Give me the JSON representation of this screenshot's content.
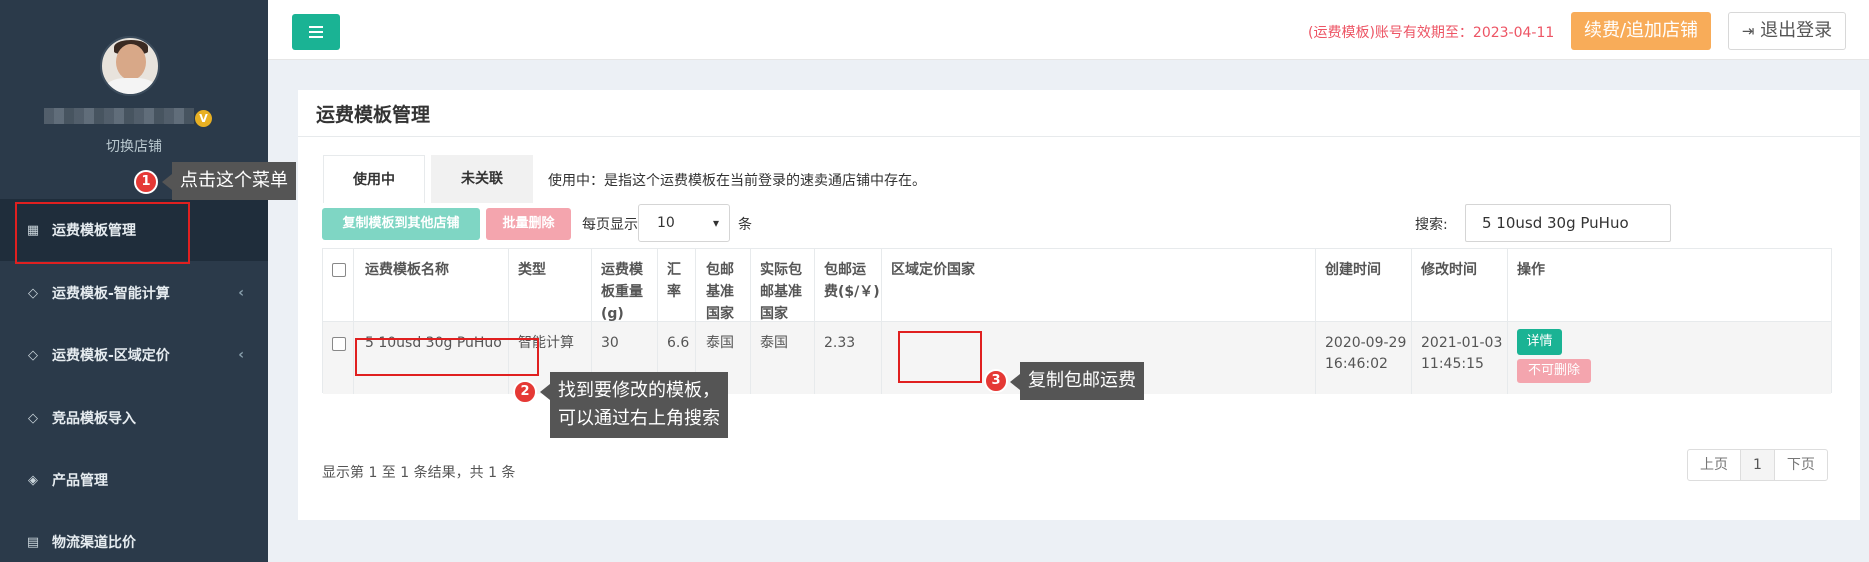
{
  "sidebar": {
    "switch_store": "切换店铺",
    "items": [
      {
        "label": "运费模板管理",
        "icon": "table-icon",
        "active": true
      },
      {
        "label": "运费模板-智能计算",
        "icon": "diamond-icon",
        "chevron": "‹"
      },
      {
        "label": "运费模板-区域定价",
        "icon": "diamond-icon",
        "chevron": "‹"
      },
      {
        "label": "竞品模板导入",
        "icon": "diamond-icon"
      },
      {
        "label": "产品管理",
        "icon": "cube-icon"
      },
      {
        "label": "物流渠道比价",
        "icon": "calculator-icon"
      }
    ],
    "vip_badge": "V"
  },
  "header": {
    "expiry_text": "(运费模板)账号有效期至：2023-04-11",
    "renew_label": "续费/追加店铺",
    "logout_label": "退出登录"
  },
  "panel": {
    "title": "运费模板管理",
    "tabs": [
      {
        "label": "使用中",
        "active": true
      },
      {
        "label": "未关联",
        "active": false
      }
    ],
    "tab_description": "使用中：是指这个运费模板在当前登录的速卖通店铺中存在。",
    "copy_button": "复制模板到其他店铺",
    "batch_delete_button": "批量删除",
    "per_page_label": "每页显示",
    "per_page_value": "10",
    "per_page_unit": "条",
    "search_label": "搜索:",
    "search_value": "5 10usd 30g PuHuo"
  },
  "table": {
    "headers": {
      "name": "运费模板名称",
      "type": "类型",
      "weight": [
        "运费模",
        "板重量",
        "(g)"
      ],
      "rate": [
        "汇",
        "率"
      ],
      "base_country": [
        "包邮",
        "基准",
        "国家"
      ],
      "actual_base_country": [
        "实际包",
        "邮基准",
        "国家"
      ],
      "free_shipping_fee": [
        "包邮运",
        "费($/￥)"
      ],
      "region_countries": "区域定价国家",
      "created": "创建时间",
      "modified": "修改时间",
      "actions": "操作"
    },
    "rows": [
      {
        "name": "5 10usd 30g PuHuo",
        "type": "智能计算",
        "weight": "30",
        "rate": "6.6",
        "base_country": "泰国",
        "actual_base_country": "泰国",
        "free_shipping_fee": "2.33",
        "region_countries": "",
        "created": [
          "2020-09-29",
          "16:46:02"
        ],
        "modified": [
          "2021-01-03",
          "11:45:15"
        ],
        "detail_button": "详情",
        "nodelete_button": "不可删除"
      }
    ]
  },
  "footer": {
    "info": "显示第 1 至 1 条结果，共 1 条",
    "prev": "上页",
    "page": "1",
    "next": "下页"
  },
  "annotations": [
    {
      "number": "1",
      "text": "点击这个菜单"
    },
    {
      "number": "2",
      "text": [
        "找到要修改的模板，",
        "可以通过右上角搜索"
      ]
    },
    {
      "number": "3",
      "text": "复制包邮运费"
    }
  ]
}
